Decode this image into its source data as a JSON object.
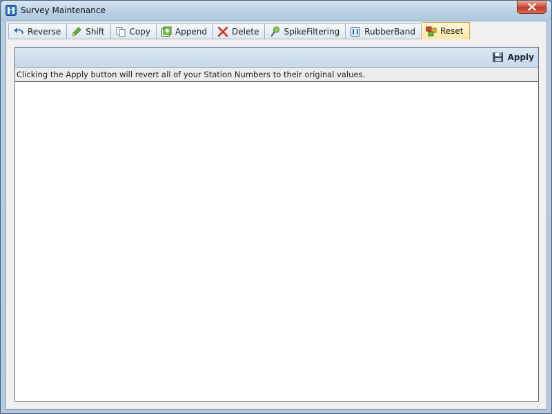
{
  "window": {
    "title": "Survey Maintenance"
  },
  "tabs": [
    {
      "label": "Reverse",
      "icon": "reverse-arrow-icon"
    },
    {
      "label": "Shift",
      "icon": "shift-pencil-icon"
    },
    {
      "label": "Copy",
      "icon": "copy-icon"
    },
    {
      "label": "Append",
      "icon": "append-icon"
    },
    {
      "label": "Delete",
      "icon": "delete-x-icon"
    },
    {
      "label": "SpikeFiltering",
      "icon": "spike-filter-icon"
    },
    {
      "label": "RubberBand",
      "icon": "rubberband-icon"
    },
    {
      "label": "Reset",
      "icon": "reset-icon"
    }
  ],
  "active_tab": "Reset",
  "toolbar": {
    "apply_label": "Apply"
  },
  "info": {
    "message": "Clicking the Apply button will revert all of your Station Numbers to their original values."
  },
  "colors": {
    "active_tab": "#fde7a6",
    "toolbar": "#c7d9ec",
    "close_button": "#c23a2a"
  }
}
